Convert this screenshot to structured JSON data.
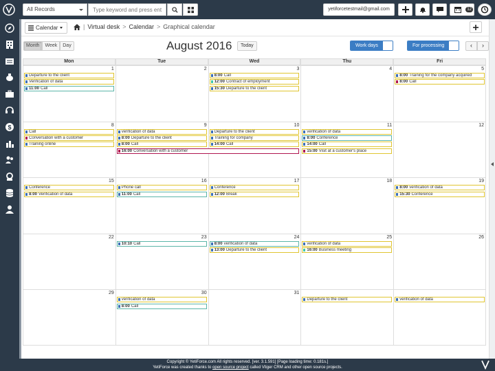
{
  "header": {
    "records_label": "All Records",
    "search_placeholder": "Type keyword and press ent",
    "user_email": "yetiforcetestmail@gmail.com",
    "reminder_count": "12"
  },
  "breadcrumb": {
    "module_dropdown": "Calendar",
    "level1": "Virtual desk",
    "level2": "Calendar",
    "level3": "Graphical calendar"
  },
  "toolbar": {
    "view_month": "Month",
    "view_week": "Week",
    "view_day": "Day",
    "title": "August 2016",
    "today": "Today",
    "work_days": "Work days",
    "for_processing": "For processing",
    "prev": "‹",
    "next": "›"
  },
  "days": [
    "Mon",
    "Tue",
    "Wed",
    "Thu",
    "Fri"
  ],
  "weeks": [
    {
      "dates": [
        "1",
        "2",
        "3",
        "4",
        "5"
      ]
    },
    {
      "dates": [
        "8",
        "9",
        "10",
        "11",
        "12"
      ]
    },
    {
      "dates": [
        "15",
        "16",
        "17",
        "18",
        "19"
      ]
    },
    {
      "dates": [
        "22",
        "23",
        "24",
        "25",
        "26"
      ]
    },
    {
      "dates": [
        "29",
        "30",
        "31",
        "",
        ""
      ]
    }
  ],
  "events": [
    {
      "w": 0,
      "d": 0,
      "slot": 0,
      "time": "",
      "title": "Departure to the client",
      "color": "#3b6fb6",
      "border": "#e0c530"
    },
    {
      "w": 0,
      "d": 0,
      "slot": 1,
      "time": "",
      "title": "Verification of data",
      "color": "#3b6fb6",
      "border": "#e0c530"
    },
    {
      "w": 0,
      "d": 0,
      "slot": 2,
      "time": "11:00",
      "title": "Call",
      "color": "#3b6fb6",
      "border": "#5bb5a8"
    },
    {
      "w": 0,
      "d": 2,
      "slot": 0,
      "time": "8:00",
      "title": "Call",
      "color": "#3b6fb6",
      "border": "#e0c530"
    },
    {
      "w": 0,
      "d": 2,
      "slot": 1,
      "time": "12:00",
      "title": "Contract of employment",
      "color": "#3ec9a8",
      "border": "#e0c530"
    },
    {
      "w": 0,
      "d": 2,
      "slot": 2,
      "time": "15:30",
      "title": "Departure to the client",
      "color": "#3b6fb6",
      "border": "#e0c530"
    },
    {
      "w": 0,
      "d": 4,
      "slot": 0,
      "time": "8:00",
      "title": "Training for the company acquired",
      "color": "#3b6fb6",
      "border": "#e0c530"
    },
    {
      "w": 0,
      "d": 4,
      "slot": 1,
      "time": "8:00",
      "title": "Call",
      "color": "#b0154f",
      "border": "#e0c530"
    },
    {
      "w": 1,
      "d": 0,
      "slot": 0,
      "time": "",
      "title": "Call",
      "color": "#3b6fb6",
      "border": "#e0c530"
    },
    {
      "w": 1,
      "d": 0,
      "slot": 1,
      "time": "",
      "title": "Conversation with a customer",
      "color": "#b0154f",
      "border": "#e0c530"
    },
    {
      "w": 1,
      "d": 0,
      "slot": 2,
      "time": "",
      "title": "Training online",
      "color": "#3b6fb6",
      "border": "#e0c530"
    },
    {
      "w": 1,
      "d": 1,
      "slot": 0,
      "time": "",
      "title": "verification of data",
      "color": "#3b6fb6",
      "border": "#e0c530"
    },
    {
      "w": 1,
      "d": 1,
      "slot": 1,
      "time": "8:00",
      "title": "Departure to the client",
      "color": "#3b6fb6",
      "border": "#e0c530"
    },
    {
      "w": 1,
      "d": 1,
      "slot": 2,
      "time": "8:00",
      "title": "Call",
      "color": "#3b6fb6",
      "border": "#e0c530"
    },
    {
      "w": 1,
      "d": 1,
      "slot": 3,
      "time": "16:00",
      "title": "Conversation with a customer",
      "color": "#b0154f",
      "border": "#b0154f",
      "span": 2
    },
    {
      "w": 1,
      "d": 2,
      "slot": 0,
      "time": "",
      "title": "Departure to the client",
      "color": "#3b6fb6",
      "border": "#e0c530"
    },
    {
      "w": 1,
      "d": 2,
      "slot": 1,
      "time": "",
      "title": "Training for company",
      "color": "#3b6fb6",
      "border": "#e0c530"
    },
    {
      "w": 1,
      "d": 2,
      "slot": 2,
      "time": "14:00",
      "title": "Call",
      "color": "#3b6fb6",
      "border": "#e0c530"
    },
    {
      "w": 1,
      "d": 3,
      "slot": 0,
      "time": "",
      "title": "verification of data",
      "color": "#3b6fb6",
      "border": "#e0c530"
    },
    {
      "w": 1,
      "d": 3,
      "slot": 1,
      "time": "8:00",
      "title": "Conference",
      "color": "#3b6fb6",
      "border": "#5bb5a8"
    },
    {
      "w": 1,
      "d": 3,
      "slot": 2,
      "time": "14:00",
      "title": "Call",
      "color": "#3b6fb6",
      "border": "#e0c530"
    },
    {
      "w": 1,
      "d": 3,
      "slot": 3,
      "time": "15:00",
      "title": "Visit at a customer's place",
      "color": "#b0154f",
      "border": "#e0c530"
    },
    {
      "w": 2,
      "d": 0,
      "slot": 0,
      "time": "",
      "title": "Conference",
      "color": "#3b6fb6",
      "border": "#e0c530"
    },
    {
      "w": 2,
      "d": 0,
      "slot": 1,
      "time": "8:00",
      "title": "Verification of data",
      "color": "#3b6fb6",
      "border": "#e0c530"
    },
    {
      "w": 2,
      "d": 1,
      "slot": 0,
      "time": "",
      "title": "Phone call",
      "color": "#3b6fb6",
      "border": "#e0c530"
    },
    {
      "w": 2,
      "d": 1,
      "slot": 1,
      "time": "11:00",
      "title": "Call",
      "color": "#3b6fb6",
      "border": "#5bb5a8"
    },
    {
      "w": 2,
      "d": 2,
      "slot": 0,
      "time": "",
      "title": "Conference",
      "color": "#3b6fb6",
      "border": "#e0c530"
    },
    {
      "w": 2,
      "d": 2,
      "slot": 1,
      "time": "12:00",
      "title": "Break",
      "color": "#3b6fb6",
      "border": "#e0c530"
    },
    {
      "w": 2,
      "d": 4,
      "slot": 0,
      "time": "8:00",
      "title": "verification of data",
      "color": "#3b6fb6",
      "border": "#e0c530"
    },
    {
      "w": 2,
      "d": 4,
      "slot": 1,
      "time": "15:30",
      "title": "Conference",
      "color": "#3b6fb6",
      "border": "#e0c530"
    },
    {
      "w": 3,
      "d": 1,
      "slot": 0,
      "time": "10:10",
      "title": "Call",
      "color": "#3b6fb6",
      "border": "#5bb5a8"
    },
    {
      "w": 3,
      "d": 2,
      "slot": 0,
      "time": "8:00",
      "title": "verification of data",
      "color": "#3b6fb6",
      "border": "#5bb5a8"
    },
    {
      "w": 3,
      "d": 2,
      "slot": 1,
      "time": "13:00",
      "title": "Departure to the client",
      "color": "#3b6fb6",
      "border": "#e0c530"
    },
    {
      "w": 3,
      "d": 3,
      "slot": 0,
      "time": "",
      "title": "verification of data",
      "color": "#3b6fb6",
      "border": "#e0c530"
    },
    {
      "w": 3,
      "d": 3,
      "slot": 1,
      "time": "16:00",
      "title": "Business meeting",
      "color": "#3ec9a8",
      "border": "#e0c530"
    },
    {
      "w": 4,
      "d": 1,
      "slot": 0,
      "time": "",
      "title": "verification of data",
      "color": "#3b6fb6",
      "border": "#e0c530"
    },
    {
      "w": 4,
      "d": 1,
      "slot": 1,
      "time": "8:00",
      "title": "Call",
      "color": "#3b6fb6",
      "border": "#5bb5a8"
    },
    {
      "w": 4,
      "d": 3,
      "slot": 0,
      "time": "",
      "title": "Departure to the client",
      "color": "#3b6fb6",
      "border": "#e0c530"
    },
    {
      "w": 4,
      "d": 4,
      "slot": 0,
      "time": "",
      "title": "verification of data",
      "color": "#3b6fb6",
      "border": "#e0c530"
    }
  ],
  "footer": {
    "line1": "Copyright © YetiForce.com All rights reserved. [ver. 3.1.591] [Page loading time: 0.181s.]",
    "line2_prefix": "YetiForce was created thanks to ",
    "line2_link": "open source project",
    "line2_suffix": " called Vtiger CRM and other open source projects."
  },
  "icons": [
    "compass-icon",
    "building-icon",
    "handshake-icon",
    "piggy-bank-icon",
    "briefcase-icon",
    "headset-icon",
    "dollar-icon",
    "chart-building-icon",
    "users-icon",
    "support-icon",
    "database-icon",
    "person-icon"
  ]
}
